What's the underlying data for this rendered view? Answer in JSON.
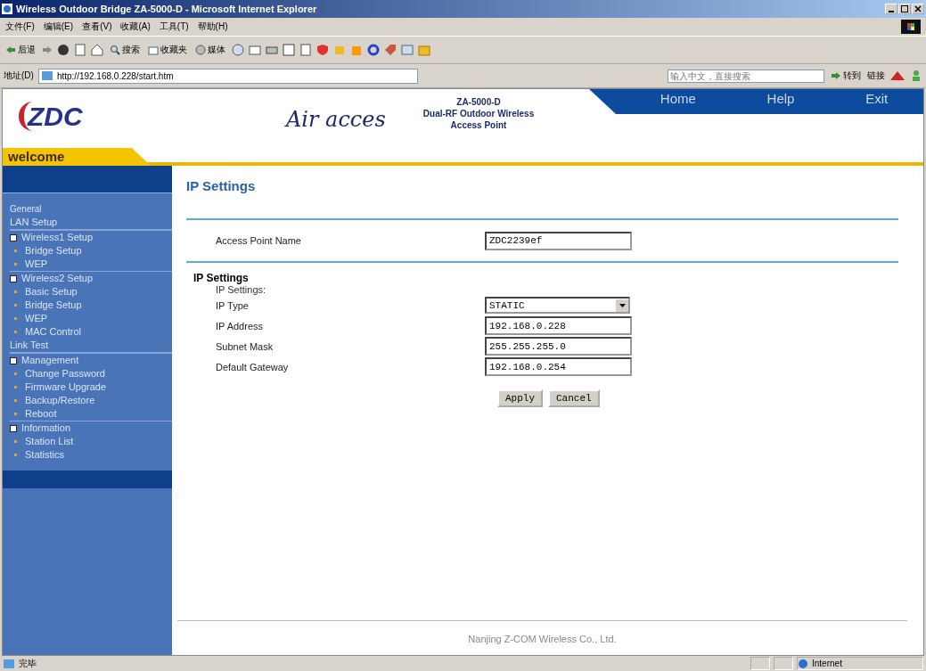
{
  "window": {
    "title": "Wireless Outdoor Bridge ZA-5000-D - Microsoft Internet Explorer"
  },
  "menu": [
    "文件(F)",
    "编辑(E)",
    "查看(V)",
    "收藏(A)",
    "工具(T)",
    "帮助(H)"
  ],
  "toolbar": {
    "back": "后退",
    "search": "搜索",
    "favorites": "收藏夹",
    "media": "媒体"
  },
  "address_bar": {
    "label": "地址(D)",
    "url": "http://192.168.0.228/start.htm",
    "search_placeholder": "输入中文，直接搜索",
    "go": "转到",
    "links": "链接"
  },
  "header": {
    "logo": "ZDC",
    "brand": "Air acces",
    "product": [
      "ZA-5000-D",
      "Dual-RF Outdoor Wireless",
      "Access Point"
    ],
    "nav": [
      "Home",
      "Help",
      "Exit"
    ],
    "welcome": "welcome"
  },
  "sidebar": [
    {
      "kind": "plain",
      "label": "General"
    },
    {
      "kind": "section",
      "label": "LAN Setup"
    },
    {
      "kind": "group",
      "label": "Wireless1 Setup",
      "children": [
        {
          "label": "Bridge Setup"
        },
        {
          "label": "WEP"
        }
      ]
    },
    {
      "kind": "group",
      "label": "Wireless2 Setup",
      "children": [
        {
          "label": "Basic Setup"
        },
        {
          "label": "Bridge Setup"
        },
        {
          "label": "WEP"
        },
        {
          "label": "MAC Control"
        }
      ]
    },
    {
      "kind": "section",
      "label": "Link Test"
    },
    {
      "kind": "group",
      "label": "Management",
      "children": [
        {
          "label": "Change Password"
        },
        {
          "label": "Firmware Upgrade"
        },
        {
          "label": "Backup/Restore"
        },
        {
          "label": "Reboot"
        }
      ]
    },
    {
      "kind": "group",
      "label": "Information",
      "children": [
        {
          "label": "Station List"
        },
        {
          "label": "Statistics"
        }
      ]
    }
  ],
  "page_title": "IP Settings",
  "ap_name": {
    "label": "Access Point Name",
    "value": "ZDC2239ef"
  },
  "section": {
    "title": "IP Settings",
    "subtitle": "IP Settings:"
  },
  "fields": [
    {
      "kind": "select",
      "label": "IP Type",
      "value": "STATIC"
    },
    {
      "kind": "text",
      "label": "IP Address",
      "value": "192.168.0.228"
    },
    {
      "kind": "text",
      "label": "Subnet Mask",
      "value": "255.255.255.0"
    },
    {
      "kind": "text",
      "label": "Default Gateway",
      "value": "192.168.0.254"
    }
  ],
  "buttons": [
    "Apply",
    "Cancel"
  ],
  "footer": "Nanjing Z-COM Wireless Co., Ltd.",
  "status_bar": {
    "text": "完毕",
    "zone": "Internet"
  }
}
